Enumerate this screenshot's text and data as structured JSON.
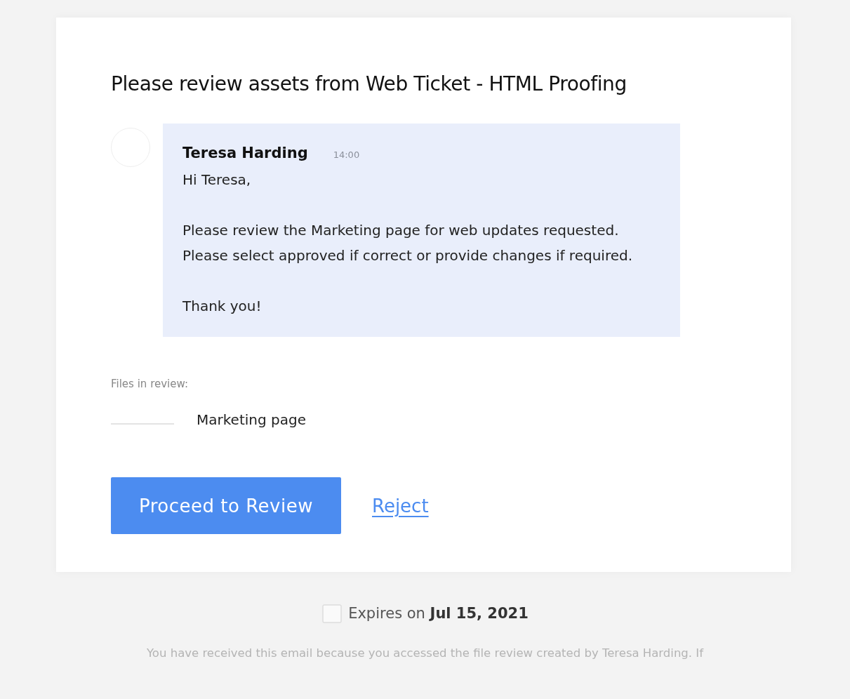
{
  "title": "Please review assets from Web Ticket - HTML Proofing",
  "message": {
    "sender": "Teresa Harding",
    "time": "14:00",
    "greeting": "Hi Teresa,",
    "paragraphs": [
      "Please review the Marketing page for web updates requested.\nPlease select approved if correct or provide changes if required.",
      "Thank you!"
    ]
  },
  "files_label": "Files in review:",
  "files": [
    {
      "name": "Marketing page"
    }
  ],
  "buttons": {
    "primary": "Proceed to Review",
    "link": "Reject"
  },
  "expires": "Expires on **Jul 15, 2021**",
  "footer": "You have received this email because you accessed the file review created by Teresa Harding. If"
}
